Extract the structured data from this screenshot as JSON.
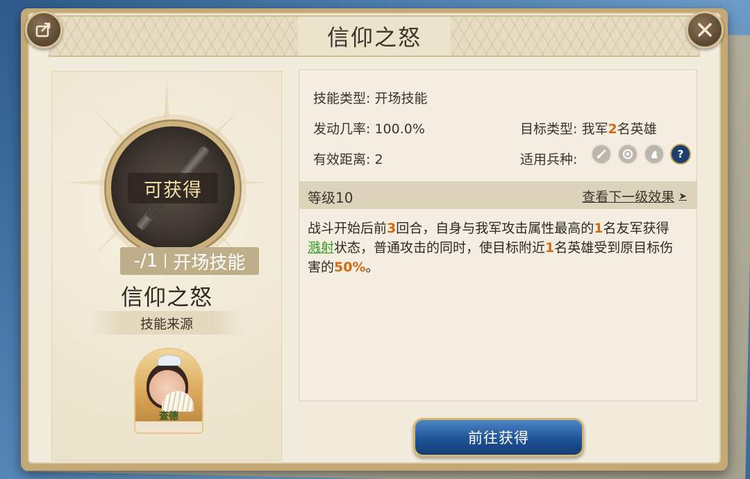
{
  "title": "信仰之怒",
  "header": {
    "share_icon": "share-icon",
    "close_icon": "close-icon"
  },
  "left": {
    "status": "可获得",
    "level_text": "-/1",
    "skill_type_short": "开场技能",
    "skill_name": "信仰之怒",
    "source_label": "技能来源",
    "hero": {
      "name": "查德"
    }
  },
  "details": {
    "skill_type": {
      "label": "技能类型:",
      "value": "开场技能"
    },
    "trigger_rate": {
      "label": "发动几率:",
      "value": "100.0%"
    },
    "range": {
      "label": "有效距离:",
      "value": "2"
    },
    "target_type": {
      "label": "目标类型:",
      "value_pre": "我军",
      "value_num": "2",
      "value_post": "名英雄"
    },
    "troop_type": {
      "label": "适用兵种:",
      "icons": [
        "sword-icon",
        "bow-icon",
        "horse-icon",
        "question-icon"
      ]
    }
  },
  "level_bar": {
    "title": "等级10",
    "next_link": "查看下一级效果",
    "next_arrow": "➤"
  },
  "description": {
    "p1": "战斗开始后前",
    "n1": "3",
    "p2": "回合，自身与我军攻击属性最高的",
    "n2": "1",
    "p3": "名友军获得",
    "keyword": "溅射",
    "p4": "状态，普通攻击的同时，使目标附近",
    "n3": "1",
    "p5": "名英雄受到原目标伤害的",
    "n4": "50%",
    "p6": "。"
  },
  "action_button": "前往获得",
  "colors": {
    "highlight": "#d26a14",
    "keyword": "#3b9a2e",
    "button": "#1f5396"
  }
}
